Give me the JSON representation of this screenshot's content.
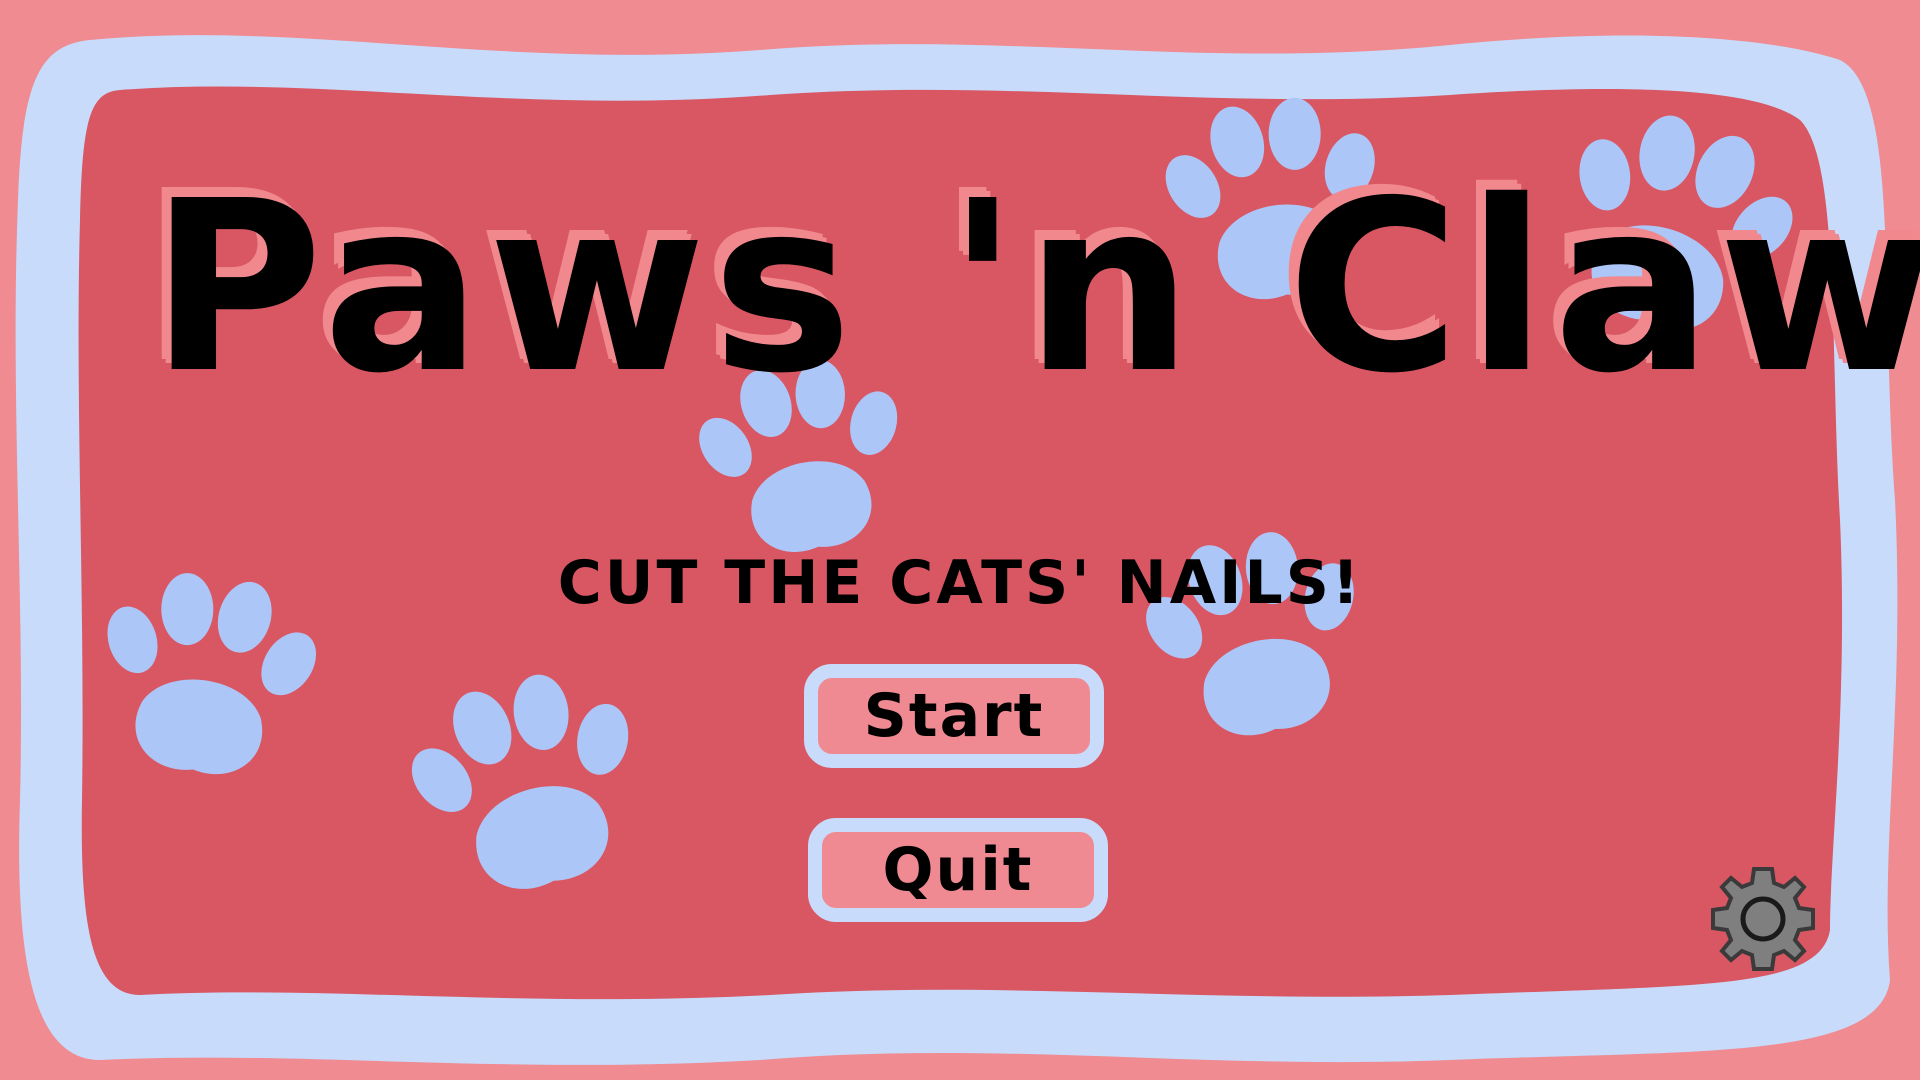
{
  "game": {
    "title": "Paws 'n Claws",
    "subtitle": "CUT THE CATS' NAILS!"
  },
  "menu": {
    "start_label": "Start",
    "quit_label": "Quit"
  },
  "icons": {
    "settings": "gear-icon",
    "decoration": "paw-print-icon"
  },
  "colors": {
    "outer_background": "#ef8b91",
    "frame_border": "#c8dbfb",
    "panel_background": "#d85763",
    "paw_prints": "#adc6f8",
    "title_text": "#000000",
    "title_shadow": "#f0888e",
    "button_fill": "#ef8a92",
    "gear": "#7f7f7f"
  }
}
